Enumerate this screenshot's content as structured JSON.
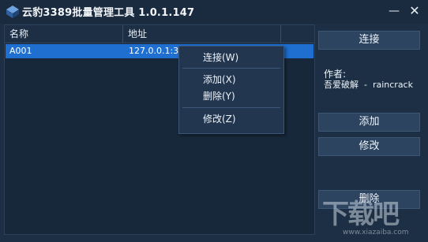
{
  "titlebar": {
    "title": "云豹3389批量管理工具 1.0.1.147",
    "minimize_glyph": "—",
    "close_glyph": "✕"
  },
  "list": {
    "columns": [
      "名称",
      "地址"
    ],
    "rows": [
      {
        "name": "A001",
        "address": "127.0.0.1:33"
      }
    ]
  },
  "context_menu": {
    "items": [
      "连接(W)",
      "添加(X)",
      "删除(Y)",
      "修改(Z)"
    ]
  },
  "sidebar": {
    "connect_label": "连接",
    "author_label": "作者:",
    "author_value": "吾爱破解  -  raincrack",
    "add_label": "添加",
    "edit_label": "修改",
    "delete_label": "删除"
  },
  "watermark": {
    "text": "下载吧",
    "url": "www.xiazaiba.com"
  },
  "colors": {
    "background": "#1d2f44",
    "selection": "#1e6fd0",
    "button": "#2c4460"
  }
}
